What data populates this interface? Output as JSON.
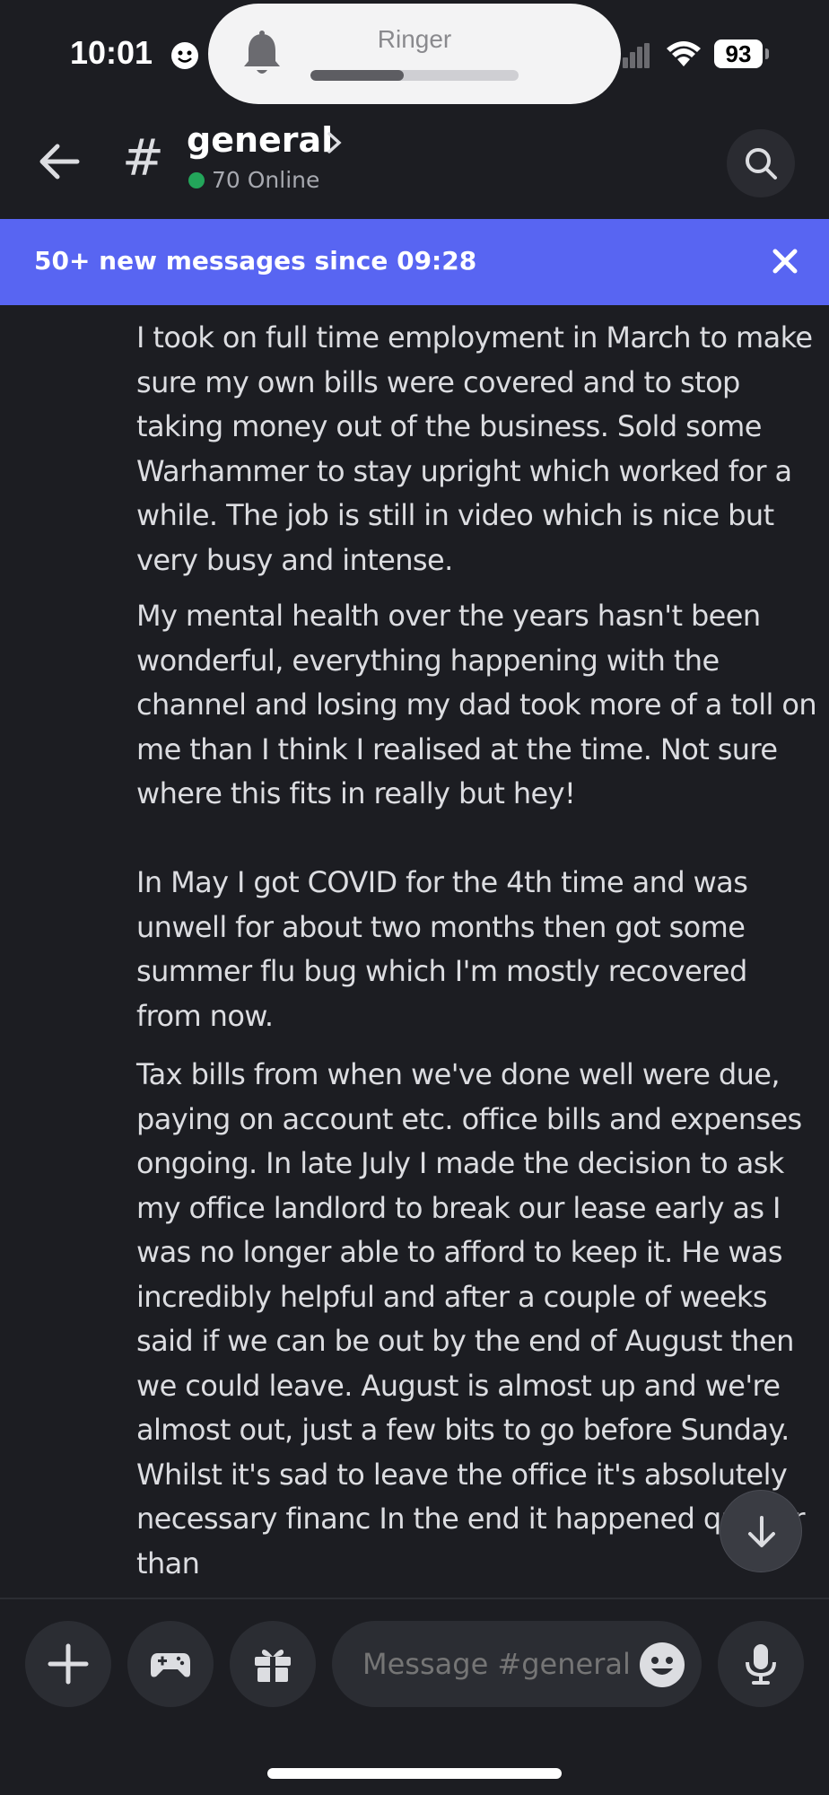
{
  "status_bar": {
    "time": "10:01",
    "ringer_label": "Ringer",
    "ringer_level": 0.45,
    "battery": "93"
  },
  "header": {
    "channel_name": "general",
    "hash": "#",
    "online_text": "70 Online"
  },
  "banner": {
    "text": "50+ new messages since 09:28"
  },
  "messages": [
    "I took on full time employment in March to make sure my own bills were covered and to stop taking money out of the business. Sold some Warhammer to stay upright which worked for a while. The job is still in video which is nice but very busy and intense.",
    "My mental health over the years hasn't been wonderful, everything happening with the channel and losing my dad took more of a toll on me than I think I realised at the time. Not sure where this fits in really but hey!\n\nIn May I got COVID for the 4th time and was unwell for about two months then got some summer flu bug which I'm mostly recovered from now.",
    "Tax bills from when we've done well were due, paying on account etc. office bills and expenses ongoing. In late July I made the decision to ask my office landlord to break our lease early as I was no longer able to afford to keep it. He was incredibly helpful and after a couple of weeks said if we can be out by the end of August then we could leave. August is almost up and we're almost out, just a few bits to go before Sunday. Whilst it's sad to leave the office it's absolutely necessary financ In the end it happened quicker than"
  ],
  "composer": {
    "placeholder": "Message #general"
  },
  "icons": {
    "back": "arrow-left-icon",
    "search": "search-icon",
    "close": "close-icon",
    "add": "plus-icon",
    "games": "gamepad-icon",
    "gift": "gift-icon",
    "emoji": "emoji-icon",
    "mic": "microphone-icon",
    "scroll_down": "arrow-down-icon"
  },
  "colors": {
    "background": "#1c1d22",
    "banner": "#5865f2",
    "online": "#23a55a"
  }
}
